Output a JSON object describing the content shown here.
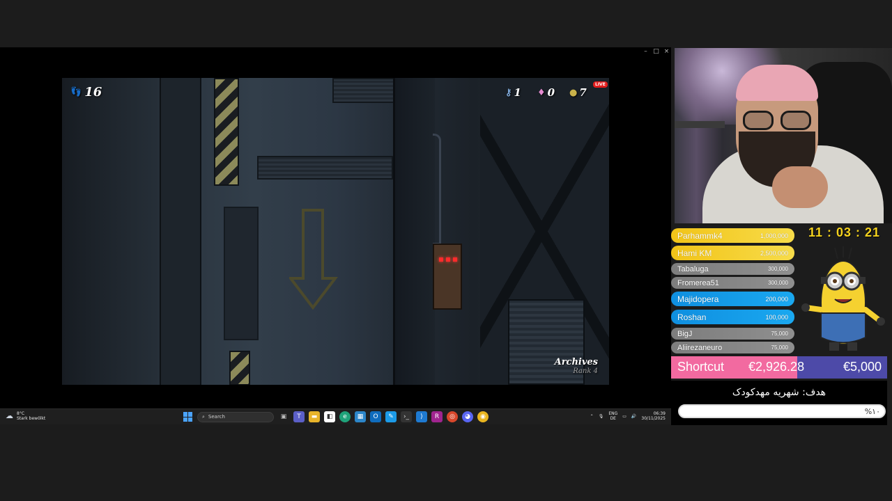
{
  "window": {
    "controls": {
      "minimize": "–",
      "maximize": "□",
      "close": "×"
    }
  },
  "game": {
    "footsteps": "16",
    "keys": "1",
    "gems": "0",
    "coins": "7",
    "live_badge": "LIVE",
    "location_name": "Archives",
    "location_rank": "Rank 4"
  },
  "taskbar": {
    "weather_temp": "8°C",
    "weather_desc": "Stark bewölkt",
    "search_placeholder": "Search",
    "lang_top": "ENG",
    "lang_bottom": "DE",
    "time": "06:39",
    "date": "30/11/2025",
    "apps": [
      "file-explorer-icon",
      "teams-icon",
      "files-icon",
      "store-icon",
      "edge-icon",
      "widgets-icon",
      "outlook-icon",
      "whiteboard-icon",
      "terminal-icon",
      "vscode-icon",
      "rider-icon",
      "chrome-dev-icon",
      "discord-icon",
      "chrome-icon"
    ]
  },
  "donations": [
    {
      "name": "Parhammk4",
      "amount": "1,000,000",
      "tier": "gold"
    },
    {
      "name": "Hami KM",
      "amount": "2,500,000",
      "tier": "gold"
    },
    {
      "name": "Tabaluga",
      "amount": "300,000",
      "tier": "gray"
    },
    {
      "name": "Fromerea51",
      "amount": "300,000",
      "tier": "gray"
    },
    {
      "name": "Majidopera",
      "amount": "200,000",
      "tier": "blue"
    },
    {
      "name": "Roshan",
      "amount": "100,000",
      "tier": "blue"
    },
    {
      "name": "BigJ",
      "amount": "75,000",
      "tier": "gray"
    },
    {
      "name": "Aliirezaneuro",
      "amount": "75,000",
      "tier": "gray"
    }
  ],
  "timer": "11 : 03 : 21",
  "goal": {
    "name": "Shortcut",
    "current": "€2,926.28",
    "target": "€5,000",
    "progress": 0.585
  },
  "tuition": {
    "title": "هدف: شهریه مهدکودک",
    "percent": "%۱۰",
    "progress": 0.1
  },
  "colors": {
    "gold": "#f2c418",
    "blue": "#1aa8f0",
    "gray": "#8f8f8f",
    "timer": "#f4d21e",
    "goal_fill": "#f26aa0",
    "goal_bg": "#4d4aa8"
  }
}
